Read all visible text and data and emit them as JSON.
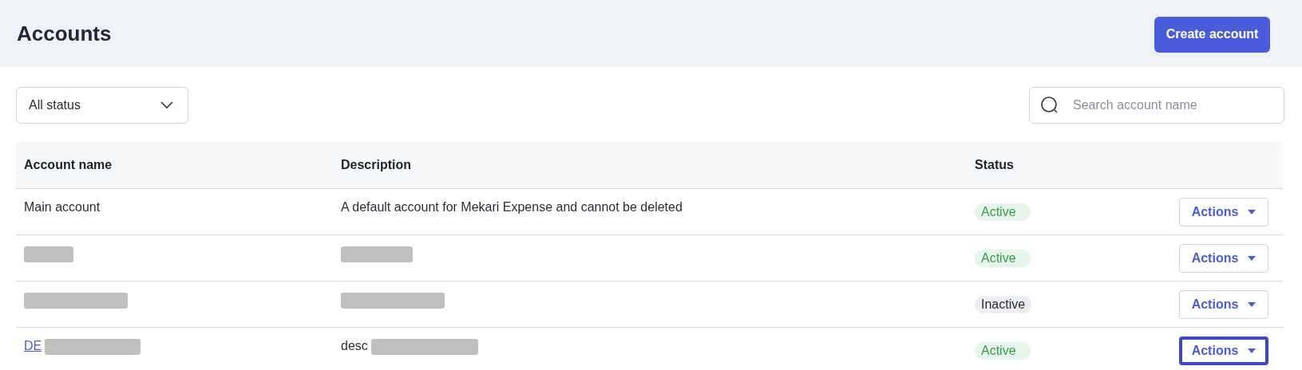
{
  "header": {
    "title": "Accounts",
    "create_button": "Create account"
  },
  "filters": {
    "status_dropdown": "All status",
    "search": {
      "placeholder": "Search account name"
    }
  },
  "table": {
    "columns": [
      "Account name",
      "Description",
      "Status"
    ],
    "rows": [
      {
        "name": {
          "text": "Main account",
          "link": false
        },
        "description": {
          "text": "A default account for Mekari Expense and cannot be deleted"
        },
        "status": {
          "label": "Active",
          "kind": "active"
        },
        "actions": {
          "label": "Actions",
          "focused": false
        }
      },
      {
        "name": {
          "redacted": true
        },
        "description": {
          "redacted": true
        },
        "status": {
          "label": "Active",
          "kind": "active"
        },
        "actions": {
          "label": "Actions",
          "focused": false
        }
      },
      {
        "name": {
          "redacted": true
        },
        "description": {
          "redacted": true
        },
        "status": {
          "label": "Inactive",
          "kind": "inactive"
        },
        "actions": {
          "label": "Actions",
          "focused": false
        }
      },
      {
        "name": {
          "text": "DE",
          "redacted": true,
          "link": true
        },
        "description": {
          "text": "desc",
          "redacted": true
        },
        "status": {
          "label": "Active",
          "kind": "active"
        },
        "actions": {
          "label": "Actions",
          "focused": true
        }
      }
    ]
  }
}
